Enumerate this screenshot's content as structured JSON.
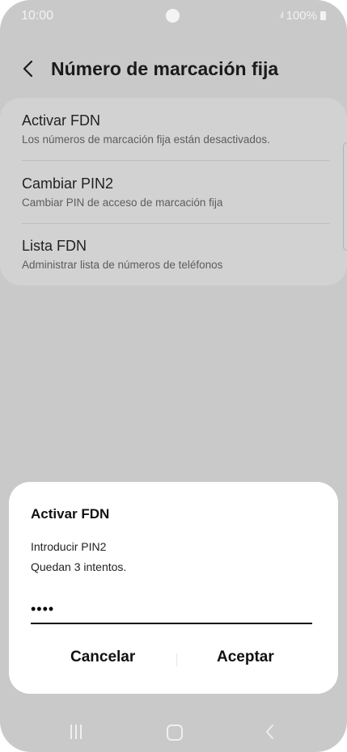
{
  "status_bar": {
    "time": "10:00",
    "signal": ".ıl",
    "battery": "100%"
  },
  "header": {
    "title": "Número de marcación fija"
  },
  "settings": {
    "items": [
      {
        "label": "Activar FDN",
        "sub": "Los números de marcación fija están desactivados."
      },
      {
        "label": "Cambiar PIN2",
        "sub": "Cambiar PIN de acceso de marcación fija"
      },
      {
        "label": "Lista FDN",
        "sub": "Administrar lista de números de teléfonos"
      }
    ]
  },
  "dialog": {
    "title": "Activar FDN",
    "line1": "Introducir PIN2",
    "line2": "Quedan 3 intentos.",
    "pin_value": "••••",
    "cancel_label": "Cancelar",
    "accept_label": "Aceptar"
  },
  "icons": {
    "back": "back-arrow-icon",
    "recent": "recent-apps-icon",
    "home": "home-icon",
    "nav_back": "nav-back-icon"
  },
  "colors": {
    "dim_background": "#c9c9c9",
    "dialog_background": "#ffffff",
    "text": "#111111"
  }
}
